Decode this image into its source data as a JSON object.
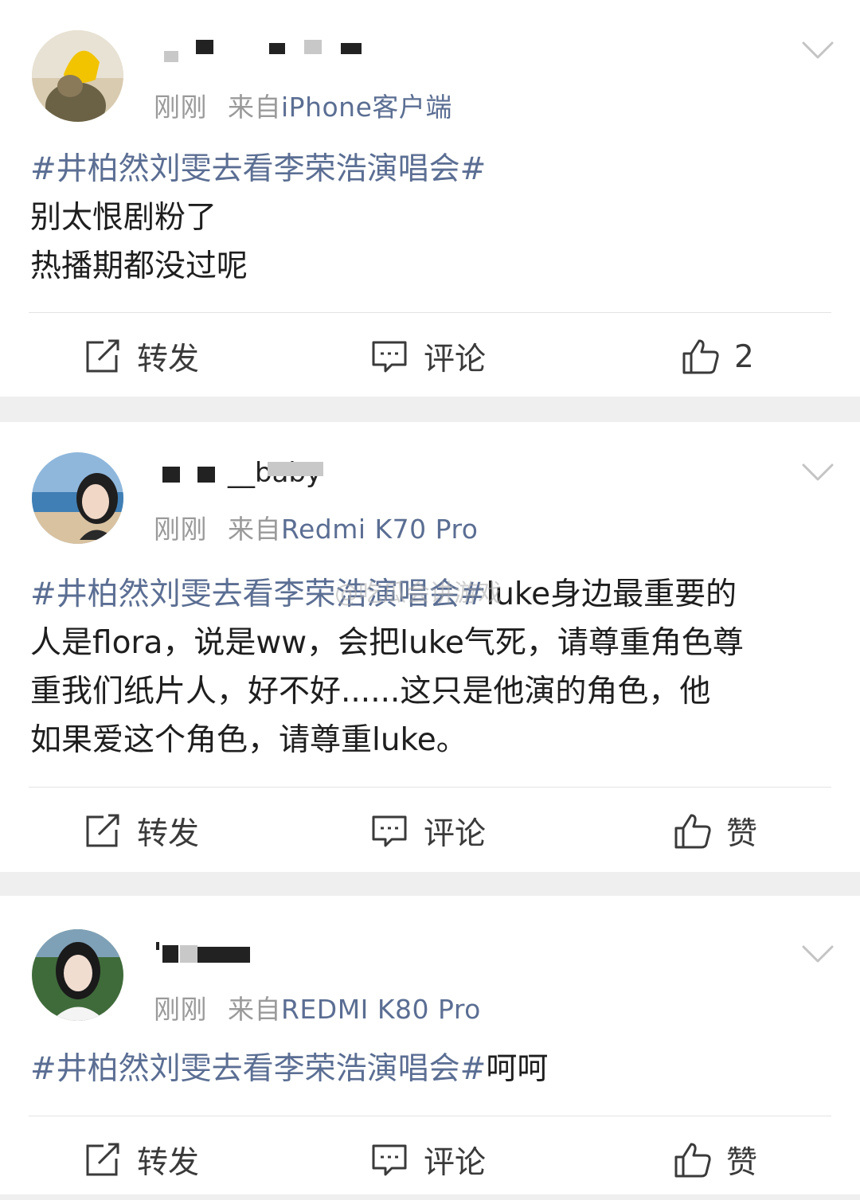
{
  "posts": [
    {
      "time": "刚刚",
      "from": "来自",
      "device": "iPhone客户端",
      "hashtag": "#井柏然刘雯去看李荣浩演唱会#",
      "lines": [
        "别太恨剧粉了",
        "热播期都没过呢"
      ],
      "actions": {
        "repost": "转发",
        "comment": "评论",
        "like": "2"
      }
    },
    {
      "username_visible": "__baby",
      "time": "刚刚",
      "from": "来自",
      "device": "Redmi K70 Pro",
      "hashtag": "#井柏然刘雯去看李荣浩演唱会#",
      "lines": [
        "luke身边最重要的",
        "人是flora，说是ww，会把luke气死，请尊重角色尊",
        "重我们纸片人，好不好......这只是他演的角色，他",
        "如果爱这个角色，请尊重luke。"
      ],
      "actions": {
        "repost": "转发",
        "comment": "评论",
        "like": "赞"
      }
    },
    {
      "time": "刚刚",
      "from": "来自",
      "device": "REDMI K80 Pro",
      "hashtag": "#井柏然刘雯去看李荣浩演唱会#",
      "lines": [
        "呵呵"
      ],
      "actions": {
        "repost": "转发",
        "comment": "评论",
        "like": "赞"
      }
    }
  ],
  "watermark": "@吃瓜会讲游戏",
  "colors": {
    "link": "#5b6e93",
    "meta": "#9a9a9a",
    "text": "#1e1e1e",
    "separator": "#efefef"
  }
}
